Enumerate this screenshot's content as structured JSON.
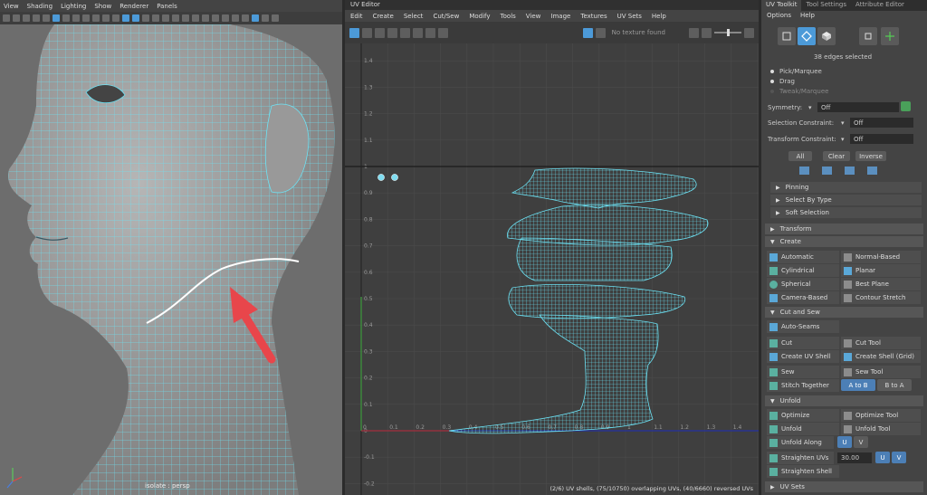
{
  "viewport": {
    "menu": [
      "View",
      "Shading",
      "Lighting",
      "Show",
      "Renderer",
      "Panels"
    ],
    "label": "isolate : persp",
    "axis_y": "Y"
  },
  "uv_editor": {
    "title": "UV Editor",
    "menu": [
      "Edit",
      "Create",
      "Select",
      "Cut/Sew",
      "Modify",
      "Tools",
      "View",
      "Image",
      "Textures",
      "UV Sets",
      "Help"
    ],
    "no_texture": "No texture found",
    "status": "(2/6) UV shells, (75/10750) overlapping UVs, (40/6660) reversed UVs",
    "y_ticks": [
      "1.4",
      "1.3",
      "1.2",
      "1.1",
      "1",
      "0.9",
      "0.8",
      "0.7",
      "0.6",
      "0.5",
      "0.4",
      "0.3",
      "0.2",
      "0.1",
      "0",
      "-0.1",
      "-0.2"
    ],
    "x_ticks": [
      "0",
      "0.1",
      "0.2",
      "0.3",
      "0.4",
      "0.5",
      "0.6",
      "0.7",
      "0.8",
      "0.9",
      "1",
      "1.1",
      "1.2",
      "1.3",
      "1.4"
    ]
  },
  "panel": {
    "tabs": [
      "UV Toolkit",
      "Tool Settings",
      "Attribute Editor"
    ],
    "menu": [
      "Options",
      "Help"
    ],
    "selection_text": "38 edges selected",
    "modes": [
      "Pick/Marquee",
      "Drag",
      "Tweak/Marquee"
    ],
    "symmetry_label": "Symmetry:",
    "symmetry_value": "Off",
    "sel_constraint_label": "Selection Constraint:",
    "sel_constraint_value": "Off",
    "xform_constraint_label": "Transform Constraint:",
    "xform_constraint_value": "Off",
    "all": "All",
    "clear": "Clear",
    "inverse": "Inverse",
    "pinning": "Pinning",
    "select_by_type": "Select By Type",
    "soft_selection": "Soft Selection",
    "transform": "Transform",
    "create": "Create",
    "create_tools": [
      "Automatic",
      "Normal-Based",
      "Cylindrical",
      "Planar",
      "Spherical",
      "Best Plane",
      "Camera-Based",
      "Contour Stretch"
    ],
    "cut_and_sew": "Cut and Sew",
    "auto_seams": "Auto-Seams",
    "cut_tools": [
      "Cut",
      "Cut Tool",
      "Create UV Shell",
      "Create Shell (Grid)",
      "Sew",
      "Sew Tool"
    ],
    "stitch_together": "Stitch Together",
    "a_to_b": "A to B",
    "b_to_a": "B to A",
    "unfold": "Unfold",
    "unfold_tools": [
      "Optimize",
      "Optimize Tool",
      "Unfold",
      "Unfold Tool"
    ],
    "unfold_along": "Unfold Along",
    "u": "U",
    "v": "V",
    "straighten_uvs": "Straighten UVs",
    "straighten_value": "30.00",
    "straighten_shell": "Straighten Shell",
    "uv_sets": "UV Sets"
  },
  "colors": {
    "accent": "#4c9ad8",
    "uv_wire": "#6ce3f5",
    "arrow": "#e8464b"
  }
}
